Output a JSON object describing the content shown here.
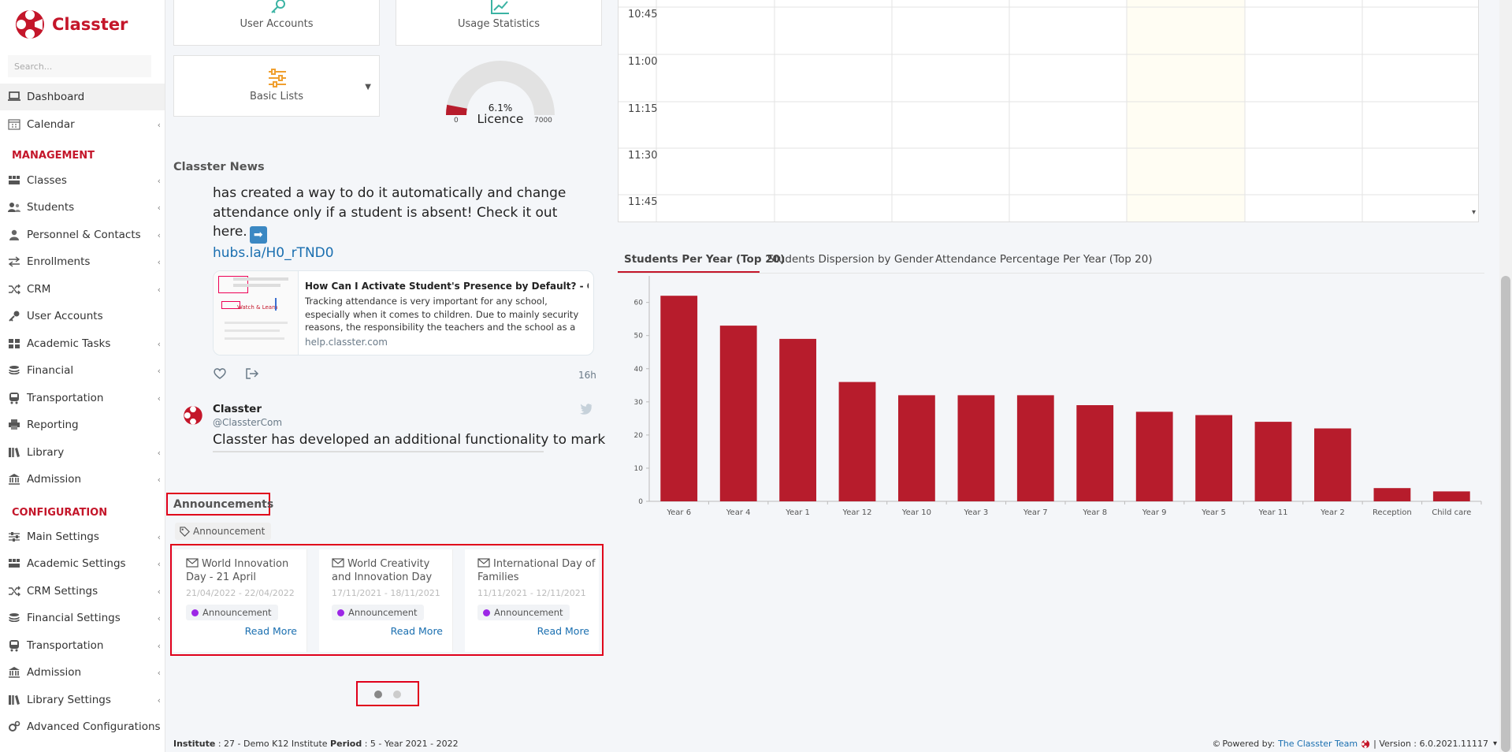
{
  "app": {
    "name": "Classter"
  },
  "search": {
    "placeholder": "Search..."
  },
  "sidebar": {
    "items": [
      {
        "label": "Dashboard",
        "icon": "laptop-icon"
      },
      {
        "label": "Calendar",
        "icon": "calendar-icon"
      },
      {
        "label": "Classes",
        "icon": "classes-icon"
      },
      {
        "label": "Students",
        "icon": "students-icon"
      },
      {
        "label": "Personnel & Contacts",
        "icon": "personnel-icon"
      },
      {
        "label": "Enrollments",
        "icon": "exchange-icon"
      },
      {
        "label": "CRM",
        "icon": "shuffle-icon"
      },
      {
        "label": "User Accounts",
        "icon": "key-icon"
      },
      {
        "label": "Academic Tasks",
        "icon": "grid-icon"
      },
      {
        "label": "Financial",
        "icon": "coins-icon"
      },
      {
        "label": "Transportation",
        "icon": "bus-icon"
      },
      {
        "label": "Reporting",
        "icon": "printer-icon"
      },
      {
        "label": "Library",
        "icon": "books-icon"
      },
      {
        "label": "Admission",
        "icon": "building-icon"
      },
      {
        "label": "Main Settings",
        "icon": "sliders-icon"
      },
      {
        "label": "Academic Settings",
        "icon": "classes-icon"
      },
      {
        "label": "CRM Settings",
        "icon": "shuffle-icon"
      },
      {
        "label": "Financial Settings",
        "icon": "coins-icon"
      },
      {
        "label": "Transportation",
        "icon": "bus-icon"
      },
      {
        "label": "Admission",
        "icon": "building-icon"
      },
      {
        "label": "Library Settings",
        "icon": "books-icon"
      },
      {
        "label": "Advanced Configurations",
        "icon": "gears-icon"
      }
    ],
    "sections": {
      "management": "MANAGEMENT",
      "configuration": "CONFIGURATION"
    }
  },
  "shortcuts": {
    "user_accounts": "User Accounts",
    "usage_statistics": "Usage Statistics",
    "basic_lists": "Basic Lists"
  },
  "licence": {
    "percent": "6.1%",
    "label": "Licence",
    "min": "0",
    "max": "7000",
    "fraction": 0.061
  },
  "news": {
    "title": "Classter News",
    "tweet1": {
      "text": "has created a way to do it automatically and change attendance only if a student is absent! Check it out here.",
      "link": "hubs.la/H0_rTND0",
      "preview_title": "How Can I Activate Student's Presence by Default? - Classter...",
      "preview_desc": "Tracking attendance is very important for any school, especially when it comes to children. Due to mainly security reasons, the responsibility the teachers and the school as a unit carry is",
      "preview_domain": "help.classter.com",
      "preview_thumb_text": "Watch & Learn",
      "time": "16h"
    },
    "tweet2": {
      "name": "Classter",
      "handle": "@ClassterCom",
      "text": "Classter has developed an additional functionality to mark"
    }
  },
  "announcements": {
    "title": "Announcements",
    "filter_tag": "Announcement",
    "items": [
      {
        "title": "World Innovation Day - 21 April",
        "dates": "21/04/2022 - 22/04/2022",
        "tag": "Announcement",
        "read_more": "Read More"
      },
      {
        "title": "World Creativity and Innovation Day",
        "dates": "17/11/2021 - 18/11/2021",
        "tag": "Announcement",
        "read_more": "Read More"
      },
      {
        "title": "International Day of Families",
        "dates": "11/11/2021 - 12/11/2021",
        "tag": "Announcement",
        "read_more": "Read More"
      }
    ]
  },
  "calendar": {
    "times": [
      "10:45",
      "11:00",
      "11:15",
      "11:30",
      "11:45"
    ]
  },
  "chart_tabs": [
    "Students Per Year (Top 20)",
    "Students Dispersion by Gender",
    "Attendance Percentage Per Year (Top 20)"
  ],
  "chart_data": {
    "type": "bar",
    "categories": [
      "Year 6",
      "Year 4",
      "Year 1",
      "Year 12",
      "Year 10",
      "Year 3",
      "Year 7",
      "Year 8",
      "Year 9",
      "Year 5",
      "Year 11",
      "Year 2",
      "Reception",
      "Child care"
    ],
    "values": [
      62,
      53,
      49,
      36,
      32,
      32,
      32,
      29,
      27,
      26,
      24,
      22,
      4,
      3
    ],
    "ylim": [
      0,
      68
    ],
    "yticks": [
      0,
      10,
      20,
      30,
      40,
      50,
      60
    ],
    "bar_color": "#b71c2c",
    "grid": false
  },
  "footer": {
    "institute_label": "Institute",
    "institute_value": ": 27 - Demo K12 Institute",
    "period_label": "Period",
    "period_value": ": 5 - Year 2021 - 2022",
    "powered_by": "Powered by:",
    "team": "The Classter Team",
    "version": "| Version : 6.0.2021.11117"
  },
  "colors": {
    "brand": "#c4162a",
    "highlight": "#e0001b",
    "link": "#1a6fb0",
    "accent_orange": "#f0a030",
    "accent_teal": "#3bb3a3"
  }
}
